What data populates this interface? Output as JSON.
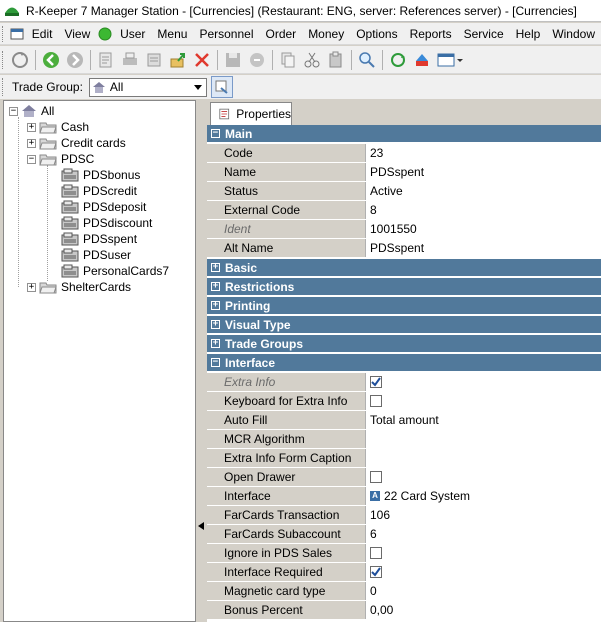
{
  "window": {
    "title": "R-Keeper 7 Manager Station - [Currencies] (Restaurant: ENG, server: References server) - [Currencies]"
  },
  "menu": {
    "items": [
      {
        "label": "Edit"
      },
      {
        "label": "View"
      },
      {
        "label": "User"
      },
      {
        "label": "Menu"
      },
      {
        "label": "Personnel"
      },
      {
        "label": "Order"
      },
      {
        "label": "Money"
      },
      {
        "label": "Options"
      },
      {
        "label": "Reports"
      },
      {
        "label": "Service"
      },
      {
        "label": "Help"
      },
      {
        "label": "Window"
      }
    ]
  },
  "trade_group": {
    "label": "Trade Group:",
    "value": "All"
  },
  "tree": {
    "root": "All",
    "items": [
      {
        "label": "Cash"
      },
      {
        "label": "Credit cards"
      },
      {
        "label": "PDSC"
      },
      {
        "label": "PDSbonus"
      },
      {
        "label": "PDScredit"
      },
      {
        "label": "PDSdeposit"
      },
      {
        "label": "PDSdiscount"
      },
      {
        "label": "PDSspent"
      },
      {
        "label": "PDSuser"
      },
      {
        "label": "PersonalCards7"
      },
      {
        "label": "ShelterCards"
      }
    ]
  },
  "tab": {
    "label": "Properties"
  },
  "sections": {
    "main": "Main",
    "basic": "Basic",
    "restrictions": "Restrictions",
    "printing": "Printing",
    "visual_type": "Visual Type",
    "trade_groups": "Trade Groups",
    "interface": "Interface"
  },
  "main_props": [
    {
      "name": "Code",
      "value": "23"
    },
    {
      "name": "Name",
      "value": "PDSspent"
    },
    {
      "name": "Status",
      "value": "Active"
    },
    {
      "name": "External Code",
      "value": "8"
    },
    {
      "name": "Ident",
      "value": "1001550"
    },
    {
      "name": "Alt Name",
      "value": "PDSspent"
    }
  ],
  "interface_props": [
    {
      "name": "Extra Info",
      "value": "",
      "checked": true
    },
    {
      "name": "Keyboard for Extra Info",
      "value": "",
      "checked": false
    },
    {
      "name": "Auto Fill",
      "value": "Total amount"
    },
    {
      "name": "MCR Algorithm",
      "value": ""
    },
    {
      "name": "Extra Info Form Caption",
      "value": ""
    },
    {
      "name": "Open Drawer",
      "value": "",
      "checked": false
    },
    {
      "name": "Interface",
      "value": "22 Card System",
      "icon": "A"
    },
    {
      "name": "FarCards Transaction",
      "value": "106"
    },
    {
      "name": "FarCards Subaccount",
      "value": "6"
    },
    {
      "name": "Ignore in PDS Sales",
      "value": "",
      "checked": false
    },
    {
      "name": "Interface Required",
      "value": "",
      "checked": true
    },
    {
      "name": "Magnetic card type",
      "value": "0"
    },
    {
      "name": "Bonus Percent",
      "value": "0,00"
    }
  ],
  "colors": {
    "section_header": "#51799b",
    "grid_label_bg": "#d4d0c8"
  }
}
